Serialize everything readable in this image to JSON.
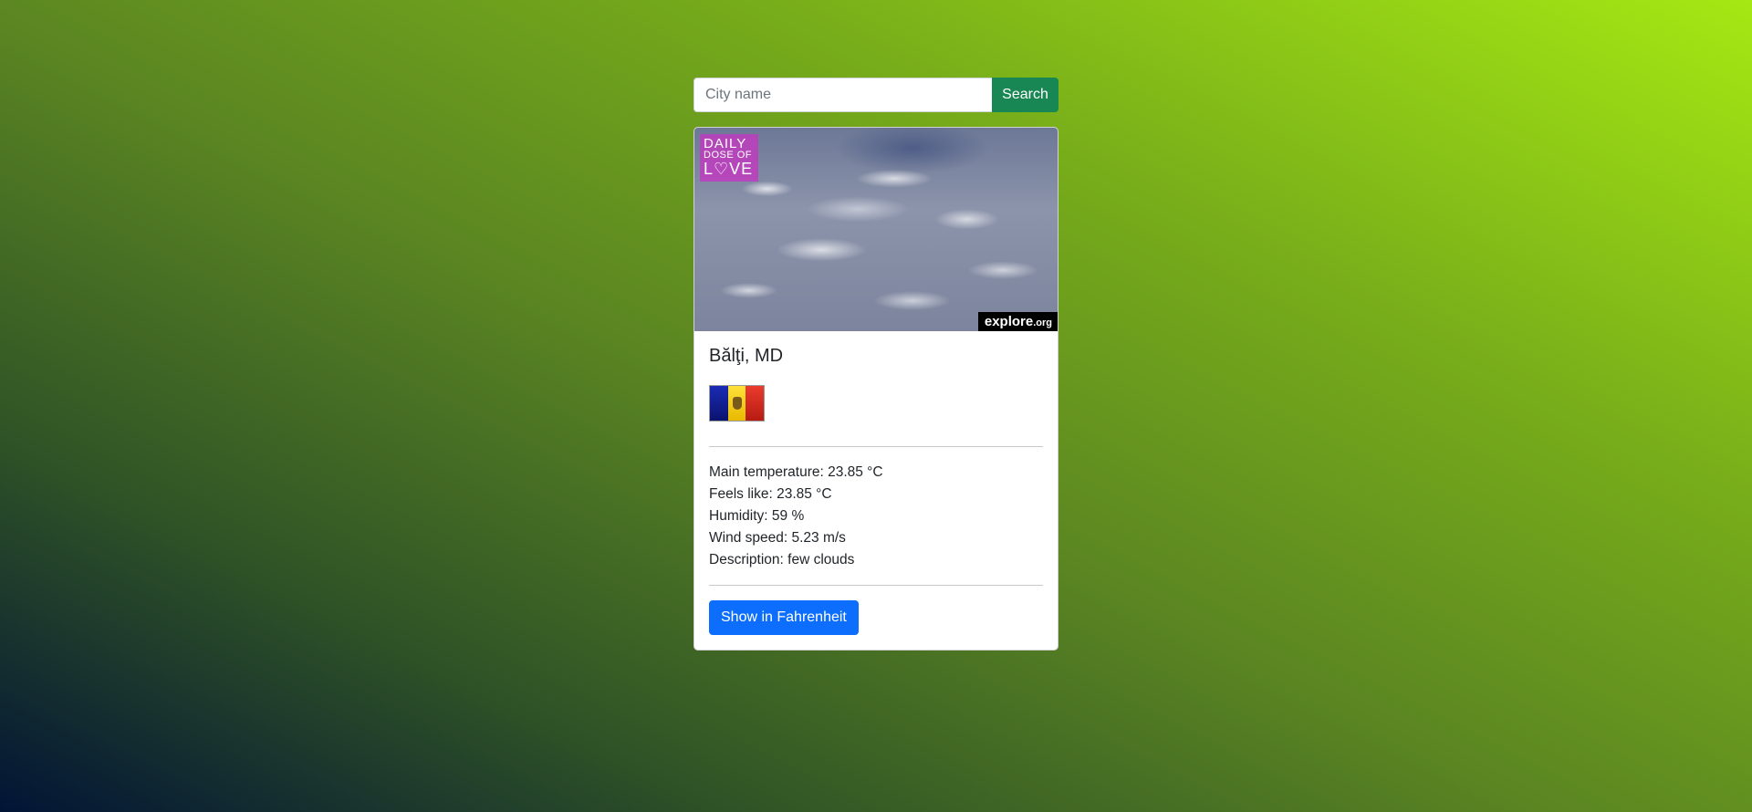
{
  "search": {
    "placeholder": "City name",
    "value": "",
    "button_label": "Search"
  },
  "card": {
    "image_overlays": {
      "top_left_line1": "DAILY",
      "top_left_line2": "DOSE OF",
      "top_left_line3": "L♡VE",
      "bottom_right": "explore",
      "bottom_right_suffix": ".org"
    },
    "city": "Bălţi, MD",
    "flag_icon": "moldova-flag",
    "weather": {
      "main_temperature": "Main temperature: 23.85 °C",
      "feels_like": "Feels like: 23.85 °C",
      "humidity": "Humidity: 59 %",
      "wind_speed": "Wind speed: 5.23 m/s",
      "description": "Description: few clouds"
    },
    "unit_button_label": "Show in Fahrenheit"
  },
  "colors": {
    "search_button": "#198754",
    "unit_button": "#0d6efd",
    "background_start": "#021436",
    "background_end": "#a5e813"
  }
}
